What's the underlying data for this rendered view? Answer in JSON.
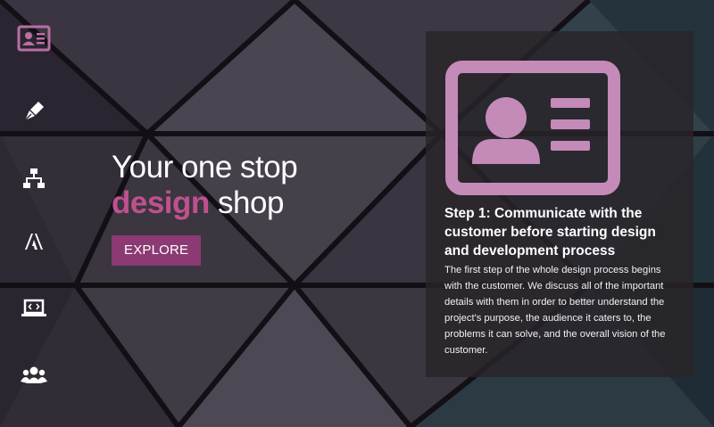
{
  "sidebar": {
    "items": [
      {
        "icon": "id-card-icon"
      },
      {
        "icon": "pen-nib-icon"
      },
      {
        "icon": "sitemap-icon"
      },
      {
        "icon": "adobe-icon"
      },
      {
        "icon": "laptop-code-icon"
      },
      {
        "icon": "users-icon"
      }
    ]
  },
  "hero": {
    "line1": "Your one stop",
    "accent": "design",
    "line2_rest": " shop",
    "button_label": "EXPLORE"
  },
  "step": {
    "icon": "id-card-icon",
    "title": "Step 1: Communicate with the customer before starting design and development process",
    "body": "The first step of the whole design process begins with the customer. We discuss all of the important details with them in order to better understand the project's purpose, the audience it caters to, the problems it can solve, and the overall vision of the customer."
  },
  "colors": {
    "accent": "#c0508f",
    "button": "#8b3a73",
    "icon_active": "#b86fa4",
    "panel_icon": "#c48ab8"
  }
}
